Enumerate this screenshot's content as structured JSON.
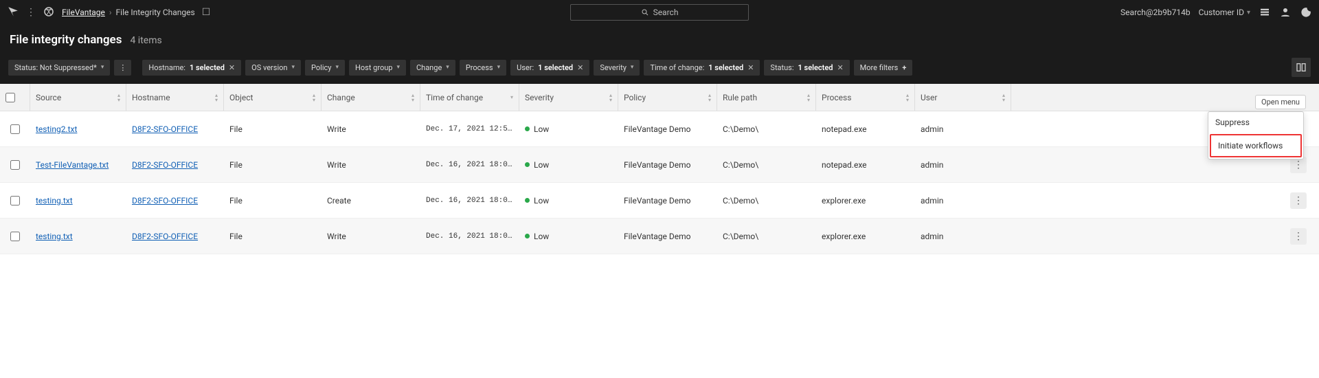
{
  "topbar": {
    "app_name": "FileVantage",
    "breadcrumb_current": "File Integrity Changes",
    "search_placeholder": "Search",
    "account_text": "Search@2b9b714b",
    "customer_id_label": "Customer ID"
  },
  "title": {
    "heading": "File integrity changes",
    "count": "4 items"
  },
  "filters": {
    "primary_status": "Status: Not Suppressed*",
    "chips": [
      {
        "label_prefix": "Hostname: ",
        "label_value": "1 selected",
        "closable": true
      },
      {
        "label_prefix": "OS version",
        "label_value": "",
        "closable": false
      },
      {
        "label_prefix": "Policy",
        "label_value": "",
        "closable": false
      },
      {
        "label_prefix": "Host group",
        "label_value": "",
        "closable": false
      },
      {
        "label_prefix": "Change",
        "label_value": "",
        "closable": false
      },
      {
        "label_prefix": "Process",
        "label_value": "",
        "closable": false
      },
      {
        "label_prefix": "User: ",
        "label_value": "1 selected",
        "closable": true
      },
      {
        "label_prefix": "Severity",
        "label_value": "",
        "closable": false
      },
      {
        "label_prefix": "Time of change: ",
        "label_value": "1 selected",
        "closable": true
      },
      {
        "label_prefix": "Status: ",
        "label_value": "1 selected",
        "closable": true
      }
    ],
    "more_label": "More filters"
  },
  "columns": {
    "source": "Source",
    "hostname": "Hostname",
    "object": "Object",
    "change": "Change",
    "time": "Time of change",
    "severity": "Severity",
    "policy": "Policy",
    "rulepath": "Rule path",
    "process": "Process",
    "user": "User"
  },
  "rows": [
    {
      "source": "testing2.txt",
      "hostname": "D8F2-SFO-OFFICE",
      "object": "File",
      "change": "Write",
      "time": "Dec. 17, 2021 12:5…",
      "severity": "Low",
      "severity_color": "low",
      "policy": "FileVantage Demo",
      "rulepath": "C:\\Demo\\",
      "process": "notepad.exe",
      "user": "admin",
      "alt": false,
      "show_menu": true
    },
    {
      "source": "Test-FileVantage.txt",
      "hostname": "D8F2-SFO-OFFICE",
      "object": "File",
      "change": "Write",
      "time": "Dec. 16, 2021 18:0…",
      "severity": "Low",
      "severity_color": "low",
      "policy": "FileVantage Demo",
      "rulepath": "C:\\Demo\\",
      "process": "notepad.exe",
      "user": "admin",
      "alt": true,
      "show_menu": false
    },
    {
      "source": "testing.txt",
      "hostname": "D8F2-SFO-OFFICE",
      "object": "File",
      "change": "Create",
      "time": "Dec. 16, 2021 18:0…",
      "severity": "Low",
      "severity_color": "low",
      "policy": "FileVantage Demo",
      "rulepath": "C:\\Demo\\",
      "process": "explorer.exe",
      "user": "admin",
      "alt": false,
      "show_menu": false
    },
    {
      "source": "testing.txt",
      "hostname": "D8F2-SFO-OFFICE",
      "object": "File",
      "change": "Write",
      "time": "Dec. 16, 2021 18:0…",
      "severity": "Low",
      "severity_color": "low",
      "policy": "FileVantage Demo",
      "rulepath": "C:\\Demo\\",
      "process": "explorer.exe",
      "user": "admin",
      "alt": true,
      "show_menu": false
    }
  ],
  "menu": {
    "open_label": "Open menu",
    "suppress": "Suppress",
    "initiate": "Initiate workflows"
  }
}
